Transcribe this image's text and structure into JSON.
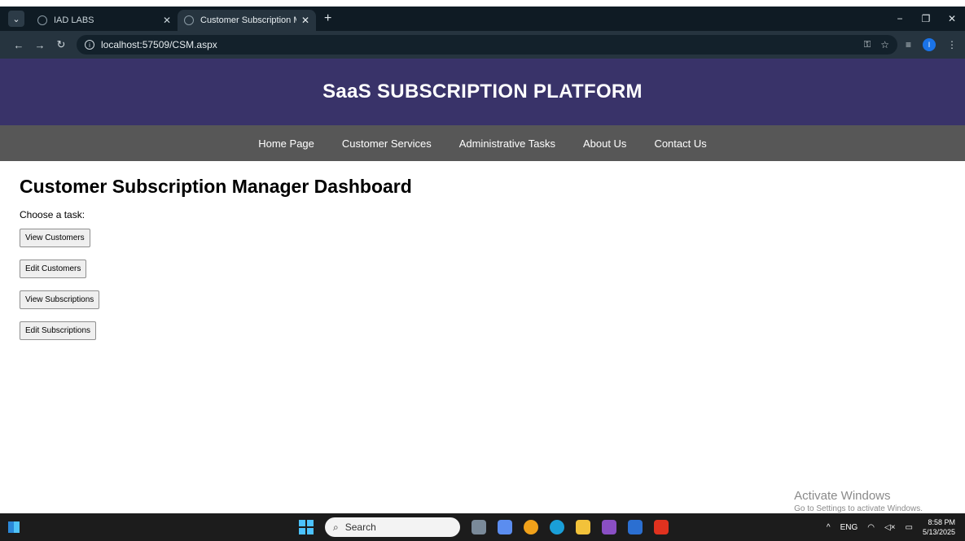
{
  "browser": {
    "tabs": [
      {
        "title": "IAD LABS",
        "active": false
      },
      {
        "title": "Customer Subscription Manage",
        "active": true
      }
    ],
    "new_tab": "+",
    "window_controls": {
      "minimize": "−",
      "restore": "❐",
      "close": "✕"
    },
    "nav": {
      "back": "←",
      "forward": "→",
      "reload": "↻"
    },
    "url": "localhost:57509/CSM.aspx"
  },
  "site": {
    "banner_title": "SaaS SUBSCRIPTION PLATFORM",
    "nav": [
      "Home Page",
      "Customer Services",
      "Administrative Tasks",
      "About Us",
      "Contact Us"
    ]
  },
  "dashboard": {
    "heading": "Customer Subscription Manager Dashboard",
    "prompt": "Choose a task:",
    "buttons": [
      "View Customers",
      "Edit Customers",
      "View Subscriptions",
      "Edit Subscriptions"
    ]
  },
  "watermark": {
    "line1": "Activate Windows",
    "line2": "Go to Settings to activate Windows."
  },
  "taskbar": {
    "search_placeholder": "Search",
    "tray": {
      "language": "ENG",
      "time": "8:58 PM",
      "date": "5/13/2025"
    }
  },
  "colors": {
    "banner": "#393369",
    "navbar": "#575757",
    "chrome_dark": "#0f1b24",
    "chrome_toolbar": "#26343f"
  }
}
